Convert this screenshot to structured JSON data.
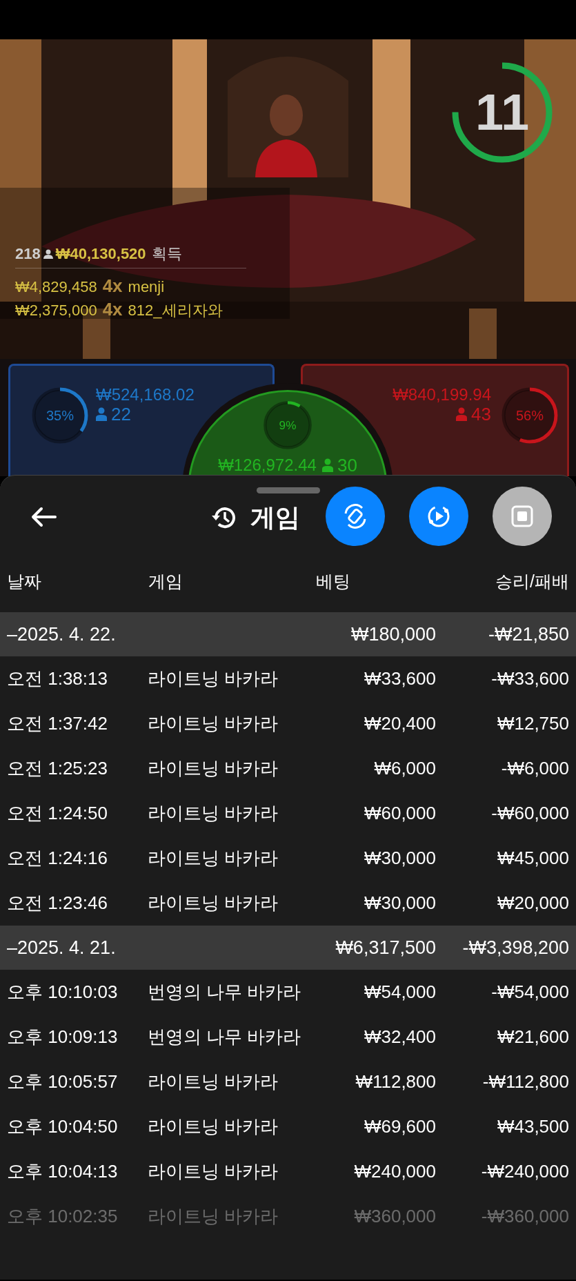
{
  "video": {
    "kind": "picture",
    "timer": {
      "text": "11",
      "level": 0.75
    },
    "winners_header": {
      "count": "218",
      "amount": "₩40,130,520",
      "label": "획득"
    },
    "winners": [
      {
        "amount": "₩4,829,458",
        "multiplier": "4x",
        "name": "menji"
      },
      {
        "amount": "₩2,375,000",
        "multiplier": "4x",
        "name": "812_세리자와"
      }
    ]
  },
  "bets": [
    {
      "kind": "player",
      "percent": "35%",
      "level": 0.35,
      "amount": "₩524,168.02",
      "players": "22"
    },
    {
      "kind": "banker",
      "percent": "56%",
      "level": 0.56,
      "amount": "₩840,199.94",
      "players": "43"
    },
    {
      "kind": "tie",
      "percent": "9%",
      "level": 0.09,
      "amount": "₩126,972.44",
      "players": "30"
    }
  ],
  "sheet": {
    "title": "게임",
    "columns": [
      "날짜",
      "게임",
      "베팅",
      "승리/패배"
    ],
    "groups": [
      {
        "date": "–2025. 4. 22.",
        "bet": "₩180,000",
        "result": "-₩21,850",
        "rows": [
          {
            "time": "오전 1:38:13",
            "game": "라이트닝 바카라",
            "bet": "₩33,600",
            "result": "-₩33,600"
          },
          {
            "time": "오전 1:37:42",
            "game": "라이트닝 바카라",
            "bet": "₩20,400",
            "result": "₩12,750"
          },
          {
            "time": "오전 1:25:23",
            "game": "라이트닝 바카라",
            "bet": "₩6,000",
            "result": "-₩6,000"
          },
          {
            "time": "오전 1:24:50",
            "game": "라이트닝 바카라",
            "bet": "₩60,000",
            "result": "-₩60,000"
          },
          {
            "time": "오전 1:24:16",
            "game": "라이트닝 바카라",
            "bet": "₩30,000",
            "result": "₩45,000"
          },
          {
            "time": "오전 1:23:46",
            "game": "라이트닝 바카라",
            "bet": "₩30,000",
            "result": "₩20,000"
          }
        ]
      },
      {
        "date": "–2025. 4. 21.",
        "bet": "₩6,317,500",
        "result": "-₩3,398,200",
        "rows": [
          {
            "time": "오후 10:10:03",
            "game": "번영의 나무 바카라",
            "bet": "₩54,000",
            "result": "-₩54,000"
          },
          {
            "time": "오후 10:09:13",
            "game": "번영의 나무 바카라",
            "bet": "₩32,400",
            "result": "₩21,600"
          },
          {
            "time": "오후 10:05:57",
            "game": "라이트닝 바카라",
            "bet": "₩112,800",
            "result": "-₩112,800"
          },
          {
            "time": "오후 10:04:50",
            "game": "라이트닝 바카라",
            "bet": "₩69,600",
            "result": "₩43,500"
          },
          {
            "time": "오후 10:04:13",
            "game": "라이트닝 바카라",
            "bet": "₩240,000",
            "result": "-₩240,000"
          },
          {
            "time": "오후 10:02:35",
            "game": "라이트닝 바카라",
            "bet": "₩360,000",
            "result": "-₩360,000"
          }
        ]
      }
    ]
  }
}
